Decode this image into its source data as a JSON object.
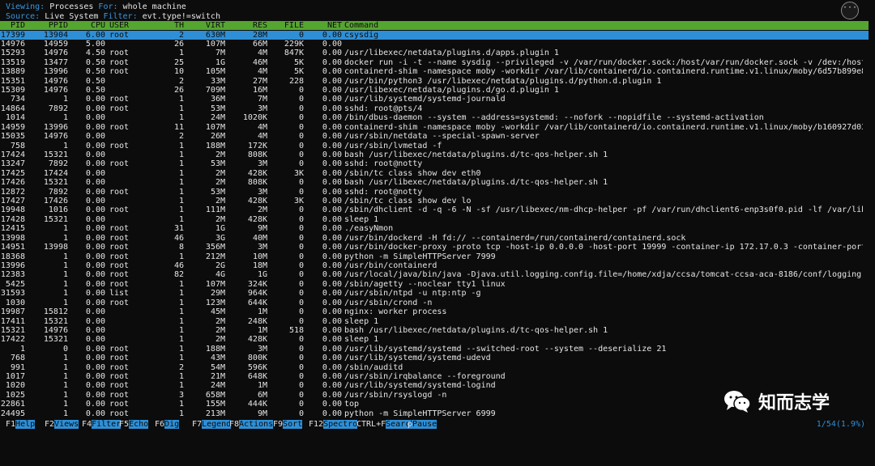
{
  "header": {
    "viewing_label": "Viewing:",
    "viewing_value": "Processes",
    "for_label": "For:",
    "for_value": "whole machine",
    "source_label": "Source:",
    "source_value": "Live System",
    "filter_label": "Filter:",
    "filter_value": "evt.type!=switch"
  },
  "menu_icon": "ellipsis-icon",
  "menu_glyph": "···",
  "columns": [
    "PID",
    "PPID",
    "CPU",
    "USER",
    "TH",
    "VIRT",
    "RES",
    "FILE",
    "NET",
    "Command"
  ],
  "rows": [
    [
      "17399",
      "13904",
      "6.00",
      "root",
      "2",
      "630M",
      "28M",
      "0",
      "0.00",
      "csysdig"
    ],
    [
      "14976",
      "14959",
      "5.00",
      "",
      "26",
      "107M",
      "66M",
      "229K",
      "0.00",
      ""
    ],
    [
      "15293",
      "14976",
      "4.50",
      "root",
      "1",
      "7M",
      "4M",
      "847K",
      "0.00",
      "/usr/libexec/netdata/plugins.d/apps.plugin 1"
    ],
    [
      "13519",
      "13477",
      "0.50",
      "root",
      "25",
      "1G",
      "46M",
      "5K",
      "0.00",
      "docker run -i -t --name sysdig --privileged -v /var/run/docker.sock:/host/var/run/docker.sock -v /dev:/host/dev -"
    ],
    [
      "13889",
      "13996",
      "0.50",
      "root",
      "10",
      "105M",
      "4M",
      "5K",
      "0.00",
      "containerd-shim -namespace moby -workdir /var/lib/containerd/io.containerd.runtime.v1.linux/moby/6d57b899e86602a7"
    ],
    [
      "15351",
      "14976",
      "0.50",
      "",
      "2",
      "33M",
      "27M",
      "228",
      "0.00",
      "/usr/bin/python3 /usr/libexec/netdata/plugins.d/python.d.plugin 1"
    ],
    [
      "15309",
      "14976",
      "0.50",
      "",
      "26",
      "709M",
      "16M",
      "0",
      "0.00",
      "/usr/libexec/netdata/plugins.d/go.d.plugin 1"
    ],
    [
      "734",
      "1",
      "0.00",
      "root",
      "1",
      "36M",
      "7M",
      "0",
      "0.00",
      "/usr/lib/systemd/systemd-journald"
    ],
    [
      "14864",
      "7892",
      "0.00",
      "root",
      "1",
      "53M",
      "3M",
      "0",
      "0.00",
      "sshd: root@pts/4"
    ],
    [
      "1014",
      "1",
      "0.00",
      "",
      "1",
      "24M",
      "1020K",
      "0",
      "0.00",
      "/bin/dbus-daemon --system --address=systemd: --nofork --nopidfile --systemd-activation"
    ],
    [
      "14959",
      "13996",
      "0.00",
      "root",
      "11",
      "107M",
      "4M",
      "0",
      "0.00",
      "containerd-shim -namespace moby -workdir /var/lib/containerd/io.containerd.runtime.v1.linux/moby/b160927d0325325c"
    ],
    [
      "15035",
      "14976",
      "0.00",
      "",
      "2",
      "26M",
      "4M",
      "0",
      "0.00",
      "/usr/sbin/netdata --special-spawn-server"
    ],
    [
      "758",
      "1",
      "0.00",
      "root",
      "1",
      "188M",
      "172K",
      "0",
      "0.00",
      "/usr/sbin/lvmetad -f"
    ],
    [
      "17424",
      "15321",
      "0.00",
      "",
      "1",
      "2M",
      "808K",
      "0",
      "0.00",
      "bash /usr/libexec/netdata/plugins.d/tc-qos-helper.sh 1"
    ],
    [
      "13247",
      "7892",
      "0.00",
      "root",
      "1",
      "53M",
      "3M",
      "0",
      "0.00",
      "sshd: root@notty"
    ],
    [
      "17425",
      "17424",
      "0.00",
      "",
      "1",
      "2M",
      "428K",
      "3K",
      "0.00",
      "/sbin/tc class show dev eth0"
    ],
    [
      "17426",
      "15321",
      "0.00",
      "",
      "1",
      "2M",
      "808K",
      "0",
      "0.00",
      "bash /usr/libexec/netdata/plugins.d/tc-qos-helper.sh 1"
    ],
    [
      "12872",
      "7892",
      "0.00",
      "root",
      "1",
      "53M",
      "3M",
      "0",
      "0.00",
      "sshd: root@notty"
    ],
    [
      "17427",
      "17426",
      "0.00",
      "",
      "1",
      "2M",
      "428K",
      "3K",
      "0.00",
      "/sbin/tc class show dev lo"
    ],
    [
      "19948",
      "1016",
      "0.00",
      "root",
      "1",
      "111M",
      "2M",
      "0",
      "0.00",
      "/sbin/dhclient -d -q -6 -N -sf /usr/libexec/nm-dhcp-helper -pf /var/run/dhclient6-enp3s0f0.pid -lf /var/lib/Netwo"
    ],
    [
      "17428",
      "15321",
      "0.00",
      "",
      "1",
      "2M",
      "428K",
      "0",
      "0.00",
      "sleep 1"
    ],
    [
      "12415",
      "1",
      "0.00",
      "root",
      "31",
      "1G",
      "9M",
      "0",
      "0.00",
      "./easyNmon"
    ],
    [
      "13998",
      "1",
      "0.00",
      "root",
      "46",
      "3G",
      "40M",
      "0",
      "0.00",
      "/usr/bin/dockerd -H fd:// --containerd=/run/containerd/containerd.sock"
    ],
    [
      "14951",
      "13998",
      "0.00",
      "root",
      "8",
      "356M",
      "3M",
      "0",
      "0.00",
      "/usr/bin/docker-proxy -proto tcp -host-ip 0.0.0.0 -host-port 19999 -container-ip 172.17.0.3 -container-port 19999"
    ],
    [
      "18368",
      "1",
      "0.00",
      "root",
      "1",
      "212M",
      "10M",
      "0",
      "0.00",
      "python -m SimpleHTTPServer 7999"
    ],
    [
      "13996",
      "1",
      "0.00",
      "root",
      "46",
      "2G",
      "18M",
      "0",
      "0.00",
      "/usr/bin/containerd"
    ],
    [
      "12383",
      "1",
      "0.00",
      "root",
      "82",
      "4G",
      "1G",
      "0",
      "0.00",
      "/usr/local/java/bin/java -Djava.util.logging.config.file=/home/xdja/ccsa/tomcat-ccsa-aca-8186/conf/logging.proper"
    ],
    [
      "5425",
      "1",
      "0.00",
      "root",
      "1",
      "107M",
      "324K",
      "0",
      "0.00",
      "/sbin/agetty --noclear tty1 linux"
    ],
    [
      "31593",
      "1",
      "0.00",
      "list",
      "1",
      "29M",
      "964K",
      "0",
      "0.00",
      "/usr/sbin/ntpd -u ntp:ntp -g"
    ],
    [
      "1030",
      "1",
      "0.00",
      "root",
      "1",
      "123M",
      "644K",
      "0",
      "0.00",
      "/usr/sbin/crond -n"
    ],
    [
      "19987",
      "15812",
      "0.00",
      "",
      "1",
      "45M",
      "1M",
      "0",
      "0.00",
      "nginx: worker process"
    ],
    [
      "17411",
      "15321",
      "0.00",
      "",
      "1",
      "2M",
      "248K",
      "0",
      "0.00",
      "sleep 1"
    ],
    [
      "15321",
      "14976",
      "0.00",
      "",
      "1",
      "2M",
      "1M",
      "518",
      "0.00",
      "bash /usr/libexec/netdata/plugins.d/tc-qos-helper.sh 1"
    ],
    [
      "17422",
      "15321",
      "0.00",
      "",
      "1",
      "2M",
      "428K",
      "0",
      "0.00",
      "sleep 1"
    ],
    [
      "1",
      "0",
      "0.00",
      "root",
      "1",
      "188M",
      "3M",
      "0",
      "0.00",
      "/usr/lib/systemd/systemd --switched-root --system --deserialize 21"
    ],
    [
      "768",
      "1",
      "0.00",
      "root",
      "1",
      "43M",
      "800K",
      "0",
      "0.00",
      "/usr/lib/systemd/systemd-udevd"
    ],
    [
      "991",
      "1",
      "0.00",
      "root",
      "2",
      "54M",
      "596K",
      "0",
      "0.00",
      "/sbin/auditd"
    ],
    [
      "1017",
      "1",
      "0.00",
      "root",
      "1",
      "21M",
      "648K",
      "0",
      "0.00",
      "/usr/sbin/irqbalance --foreground"
    ],
    [
      "1020",
      "1",
      "0.00",
      "root",
      "1",
      "24M",
      "1M",
      "0",
      "0.00",
      "/usr/lib/systemd/systemd-logind"
    ],
    [
      "1025",
      "1",
      "0.00",
      "root",
      "3",
      "658M",
      "6M",
      "0",
      "0.00",
      "/usr/sbin/rsyslogd -n"
    ],
    [
      "22861",
      "1",
      "0.00",
      "root",
      "1",
      "155M",
      "444K",
      "0",
      "0.00",
      "top"
    ],
    [
      "24495",
      "1",
      "0.00",
      "root",
      "1",
      "213M",
      "9M",
      "0",
      "0.00",
      "python -m SimpleHTTPServer 6999"
    ]
  ],
  "footer": {
    "keys": [
      {
        "key": "F1",
        "label": "Help"
      },
      {
        "key": "F2",
        "label": "Views"
      },
      {
        "key": "F4",
        "label": "Filter"
      },
      {
        "key": "F5",
        "label": "Echo"
      },
      {
        "key": "F6",
        "label": "Dig"
      },
      {
        "key": "F7",
        "label": "Legend"
      },
      {
        "key": "F8",
        "label": "Actions"
      },
      {
        "key": "F9",
        "label": "Sort"
      },
      {
        "key": "F12",
        "label": "Spectro"
      },
      {
        "key": "CTRL+F",
        "label": "Search"
      },
      {
        "key": "p",
        "label": "Pause"
      }
    ],
    "pager": "1/54(1.9%)"
  },
  "watermark": {
    "icon": "wechat-icon",
    "text": "知而志学"
  }
}
